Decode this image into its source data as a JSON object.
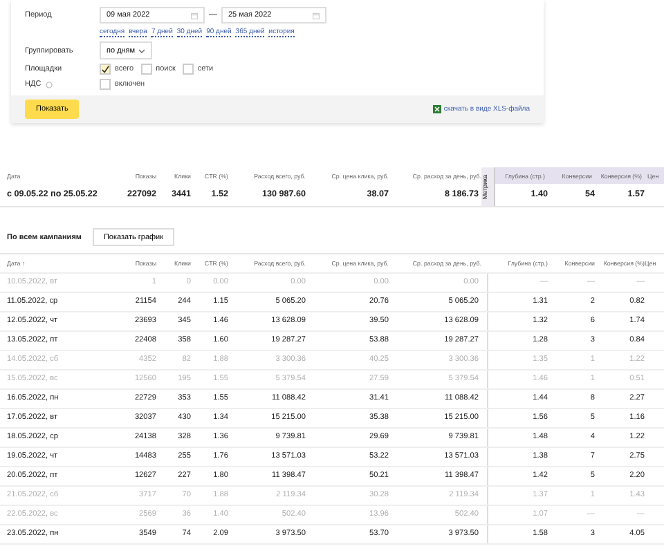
{
  "filters": {
    "period_label": "Период",
    "date_from": "09 мая 2022",
    "date_separator": "—",
    "date_to": "25 мая 2022",
    "quick_links": [
      "сегодня",
      "вчера",
      "7 дней",
      "30 дней",
      "90 дней",
      "365 дней",
      "история"
    ],
    "group_label": "Группировать",
    "group_value": "по дням",
    "sites_label": "Площадки",
    "sites": [
      {
        "label": "всего",
        "checked": true
      },
      {
        "label": "поиск",
        "checked": false
      },
      {
        "label": "сети",
        "checked": false
      }
    ],
    "vat_label": "НДС",
    "vat": {
      "label": "включен",
      "checked": false
    },
    "show_button": "Показать",
    "download_link": "скачать в виде XLS-файла"
  },
  "summary": {
    "columns": [
      "Дата",
      "Показы",
      "Клики",
      "CTR (%)",
      "Расход всего, руб.",
      "Ср. цена клика, руб.",
      "Ср. расход за день, руб."
    ],
    "metrika_label": "Метрика",
    "metrika_columns": [
      "Глубина (стр.)",
      "Конверсии",
      "Конверсия (%)",
      "Цен"
    ],
    "row": [
      "с 09.05.22 по 25.05.22",
      "227092",
      "3441",
      "1.52",
      "130 987.60",
      "38.07",
      "8 186.73",
      "1.40",
      "54",
      "1.57"
    ]
  },
  "campaigns": {
    "title": "По всем кампаниям",
    "chart_button": "Показать график"
  },
  "table": {
    "columns": [
      "Дата ↑",
      "Показы",
      "Клики",
      "CTR (%)",
      "Расход всего, руб.",
      "Ср. цена клика, руб.",
      "Ср. расход за день, руб.",
      "Глубина (стр.)",
      "Конверсии",
      "Конверсия (%)",
      "Цен"
    ],
    "rows": [
      {
        "muted": true,
        "cells": [
          "10.05.2022, вт",
          "1",
          "0",
          "0.00",
          "0.00",
          "0.00",
          "0.00",
          "—",
          "—",
          "—"
        ]
      },
      {
        "muted": false,
        "cells": [
          "11.05.2022, ср",
          "21154",
          "244",
          "1.15",
          "5 065.20",
          "20.76",
          "5 065.20",
          "1.31",
          "2",
          "0.82"
        ]
      },
      {
        "muted": false,
        "cells": [
          "12.05.2022, чт",
          "23693",
          "345",
          "1.46",
          "13 628.09",
          "39.50",
          "13 628.09",
          "1.32",
          "6",
          "1.74"
        ]
      },
      {
        "muted": false,
        "cells": [
          "13.05.2022, пт",
          "22408",
          "358",
          "1.60",
          "19 287.27",
          "53.88",
          "19 287.27",
          "1.28",
          "3",
          "0.84"
        ]
      },
      {
        "muted": true,
        "cells": [
          "14.05.2022, сб",
          "4352",
          "82",
          "1.88",
          "3 300.36",
          "40.25",
          "3 300.36",
          "1.35",
          "1",
          "1.22"
        ]
      },
      {
        "muted": true,
        "cells": [
          "15.05.2022, вс",
          "12560",
          "195",
          "1.55",
          "5 379.54",
          "27.59",
          "5 379.54",
          "1.46",
          "1",
          "0.51"
        ]
      },
      {
        "muted": false,
        "cells": [
          "16.05.2022, пн",
          "22729",
          "353",
          "1.55",
          "11 088.42",
          "31.41",
          "11 088.42",
          "1.44",
          "8",
          "2.27"
        ]
      },
      {
        "muted": false,
        "cells": [
          "17.05.2022, вт",
          "32037",
          "430",
          "1.34",
          "15 215.00",
          "35.38",
          "15 215.00",
          "1.56",
          "5",
          "1.16"
        ]
      },
      {
        "muted": false,
        "cells": [
          "18.05.2022, ср",
          "24138",
          "328",
          "1.36",
          "9 739.81",
          "29.69",
          "9 739.81",
          "1.48",
          "4",
          "1.22"
        ]
      },
      {
        "muted": false,
        "cells": [
          "19.05.2022, чт",
          "14483",
          "255",
          "1.76",
          "13 571.03",
          "53.22",
          "13 571.03",
          "1.38",
          "7",
          "2.75"
        ]
      },
      {
        "muted": false,
        "cells": [
          "20.05.2022, пт",
          "12627",
          "227",
          "1.80",
          "11 398.47",
          "50.21",
          "11 398.47",
          "1.42",
          "5",
          "2.20"
        ]
      },
      {
        "muted": true,
        "cells": [
          "21.05.2022, сб",
          "3717",
          "70",
          "1.88",
          "2 119.34",
          "30.28",
          "2 119.34",
          "1.37",
          "1",
          "1.43"
        ]
      },
      {
        "muted": true,
        "cells": [
          "22.05.2022, вс",
          "2569",
          "36",
          "1.40",
          "502.40",
          "13.96",
          "502.40",
          "1.07",
          "—",
          "—"
        ]
      },
      {
        "muted": false,
        "cells": [
          "23.05.2022, пн",
          "3549",
          "74",
          "2.09",
          "3 973.50",
          "53.70",
          "3 973.50",
          "1.58",
          "3",
          "4.05"
        ]
      }
    ]
  }
}
